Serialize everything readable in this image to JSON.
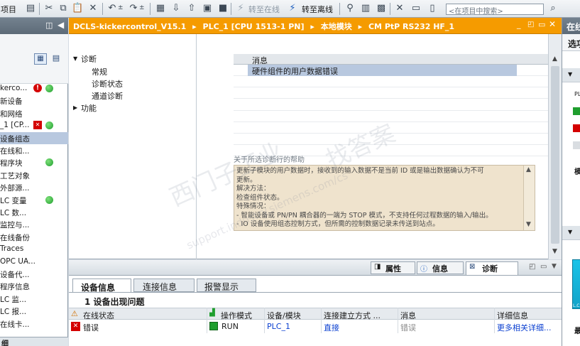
{
  "toolbar": {
    "project_menu": "项目",
    "go_online": "转至在线",
    "go_offline": "转至离线",
    "search_placeholder": "<在项目中搜索>"
  },
  "right_panel": {
    "header_title": "在线",
    "options_label": "选项",
    "partial_text": "模",
    "bottom_text": "最",
    "bottom_small": "L.C"
  },
  "tree": {
    "bottom_label": "细",
    "items": [
      {
        "label": "kerco..."
      },
      {
        "label": "新设备"
      },
      {
        "label": "和网络"
      },
      {
        "label": "_1 [CP..."
      },
      {
        "label": "设备组态"
      },
      {
        "label": "在线和..."
      },
      {
        "label": "程序块"
      },
      {
        "label": "工艺对象"
      },
      {
        "label": "外部源..."
      },
      {
        "label": "LC 变量"
      },
      {
        "label": "LC 数..."
      },
      {
        "label": "监控与..."
      },
      {
        "label": "在线备份"
      },
      {
        "label": "Traces"
      },
      {
        "label": "OPC UA..."
      },
      {
        "label": "设备代..."
      },
      {
        "label": "程序信息"
      },
      {
        "label": "LC 监..."
      },
      {
        "label": "LC 报..."
      },
      {
        "label": "在线卡..."
      }
    ]
  },
  "breadcrumb": {
    "project": "DCLS-kickercontrol_V15.1",
    "plc": "PLC_1 [CPU 1513-1 PN]",
    "local_modules": "本地模块",
    "module": "CM PtP RS232 HF_1"
  },
  "diag_nav": {
    "diagnostics": "诊断",
    "general": "常规",
    "diag_status": "诊断状态",
    "channel_diag": "通道诊断",
    "functions": "功能"
  },
  "message_table": {
    "header": "消息",
    "rows": [
      "硬件组件的用户数据错误"
    ]
  },
  "help": {
    "title": "关于所选诊断行的帮助",
    "lines": [
      "更新子模块的用户数据时，接收到的输入数据不是当前 ID 或是输出数据确认为不可",
      "更新。",
      "解决方法：",
      "检查组件状态。",
      "特殊情况：",
      "- 智能设备或 PN/PN 耦合器的一端为 STOP 模式，不支持任何过程数据的输入/输出。",
      "- IO 设备使用组态控制方式，但所需的控制数据记录未传送到站点。"
    ]
  },
  "inspector": {
    "tab_properties": "属性",
    "tab_info": "信息",
    "tab_diagnostics": "诊断",
    "subtab_device_info": "设备信息",
    "subtab_connection_info": "连接信息",
    "subtab_alarm_display": "报警显示",
    "problem_count": "1 设备出现问题",
    "columns": {
      "online_status": "在线状态",
      "operating_mode": "操作模式",
      "device_module": "设备/模块",
      "connection_method": "连接建立方式 ...",
      "message": "消息",
      "details": "详细信息"
    },
    "rows": [
      {
        "online_status": "错误",
        "operating_mode": "RUN",
        "device_module": "PLC_1",
        "connection_method": "直接",
        "message": "错误",
        "details": "更多相关详细..."
      }
    ]
  },
  "watermark": {
    "line1": "西门子工业",
    "line2": "support.industry.siemens.com/cs",
    "line3": "找答案"
  },
  "colors": {
    "orange_header": "#f59b00",
    "selected_row": "#b8c8df",
    "help_bg": "#efe3cd",
    "error_red": "#d40000",
    "ok_green": "#1f9e2e",
    "link_blue": "#0a3fd0"
  }
}
